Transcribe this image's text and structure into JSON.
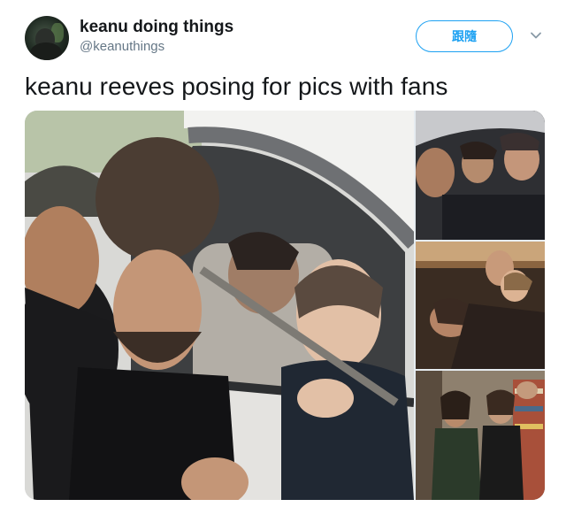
{
  "user": {
    "display_name": "keanu doing things",
    "handle": "@keanuthings",
    "avatar_icon": "profile-photo"
  },
  "follow_button": {
    "label": "跟隨"
  },
  "menu_caret_icon": "chevron-down-icon",
  "tweet": {
    "text": "keanu reeves posing for pics with fans"
  },
  "media": {
    "count": 4,
    "items": [
      {
        "name": "car-window-selfie"
      },
      {
        "name": "group-in-car"
      },
      {
        "name": "group-hug"
      },
      {
        "name": "bookstore-photo"
      }
    ]
  },
  "colors": {
    "accent": "#1da1f2",
    "text": "#14171a",
    "secondary": "#657786"
  }
}
